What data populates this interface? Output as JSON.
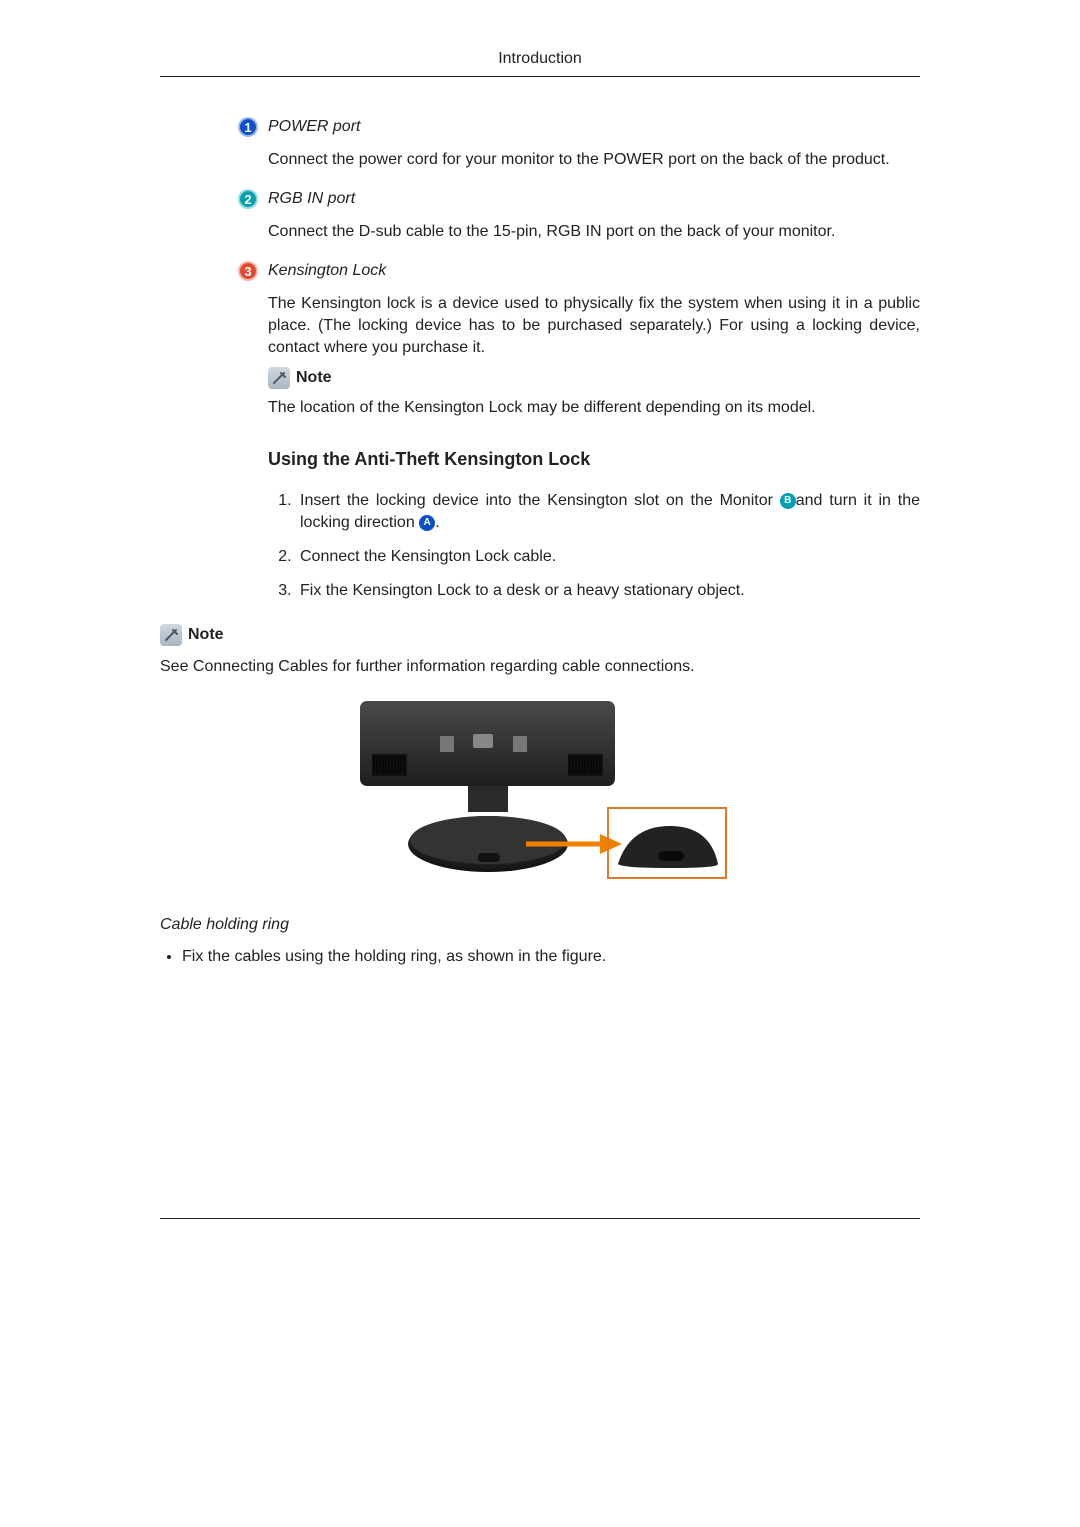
{
  "header": {
    "title": "Introduction"
  },
  "items": [
    {
      "num": "1",
      "color": "blue",
      "title": "POWER port",
      "body": "Connect the power cord for your monitor to the POWER port on the back of the product."
    },
    {
      "num": "2",
      "color": "teal",
      "title": "RGB IN port",
      "body": "Connect the D-sub cable to the 15-pin, RGB IN port on the back of your monitor."
    },
    {
      "num": "3",
      "color": "orange",
      "title": "Kensington Lock",
      "body": "The Kensington lock is a device used to physically fix the system when using it in a public place. (The locking device has to be purchased separately.) For using a locking device, contact where you purchase it."
    }
  ],
  "note1": {
    "label": "Note",
    "body": "The location of the Kensington Lock may be different depending on its model."
  },
  "section2": {
    "title": "Using the Anti-Theft Kensington Lock",
    "steps": {
      "s1a": "Insert the locking device into the Kensington slot on the Monitor ",
      "badgeA": "B",
      "s1b": "and turn it in the locking direction ",
      "badgeB": "A",
      "s1c": ".",
      "s2": "Connect the Kensington Lock cable.",
      "s3": "Fix the Kensington Lock to a desk or a heavy stationary object."
    }
  },
  "note2": {
    "label": "Note",
    "body": "See Connecting Cables for further information regarding cable connections."
  },
  "cable_ring": {
    "title": "Cable holding ring",
    "bullet": "Fix the cables using the holding ring, as shown in the figure."
  }
}
